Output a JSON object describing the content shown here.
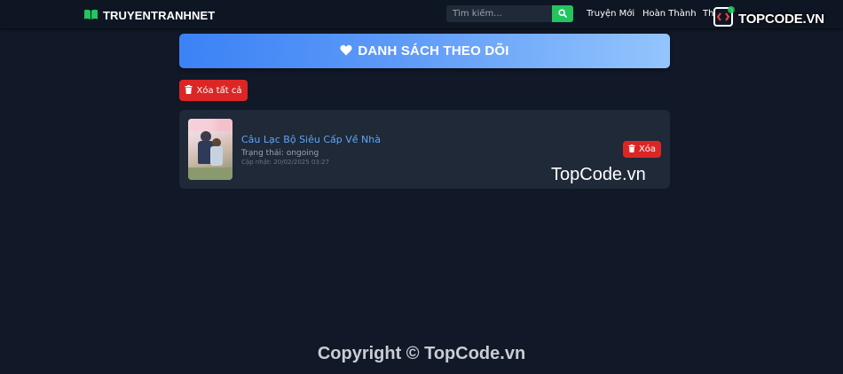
{
  "navbar": {
    "brand": "TRUYENTRANHNET",
    "brand_icon": "book-open-icon",
    "brand_color": "#22c55e",
    "search": {
      "placeholder": "Tìm kiếm...",
      "value": ""
    },
    "links": [
      {
        "label": "Truyện Mới"
      },
      {
        "label": "Hoàn Thành"
      },
      {
        "label": "Th"
      }
    ]
  },
  "banner": {
    "icon": "heart-icon",
    "title": "DANH SÁCH THEO DÕI",
    "gradient_from": "#3b82f6",
    "gradient_to": "#93c5fd"
  },
  "actions": {
    "clear_all_label": "Xóa tất cả",
    "clear_all_icon": "trash-icon"
  },
  "items": [
    {
      "title": "Câu Lạc Bộ Siêu Cấp Về Nhà",
      "status": "Trạng thái: ongoing",
      "updated": "Cập nhật: 20/02/2025 03:27",
      "remove_label": "Xóa"
    }
  ],
  "watermark": {
    "logo_text": "TOPCODE.VN",
    "mid_text": "TopCode.vn"
  },
  "footer": {
    "copyright": "Copyright © TopCode.vn"
  },
  "colors": {
    "background": "#111827",
    "card": "#1f2937",
    "danger": "#dc2626",
    "link": "#60a5fa",
    "search_button": "#22c55e"
  }
}
